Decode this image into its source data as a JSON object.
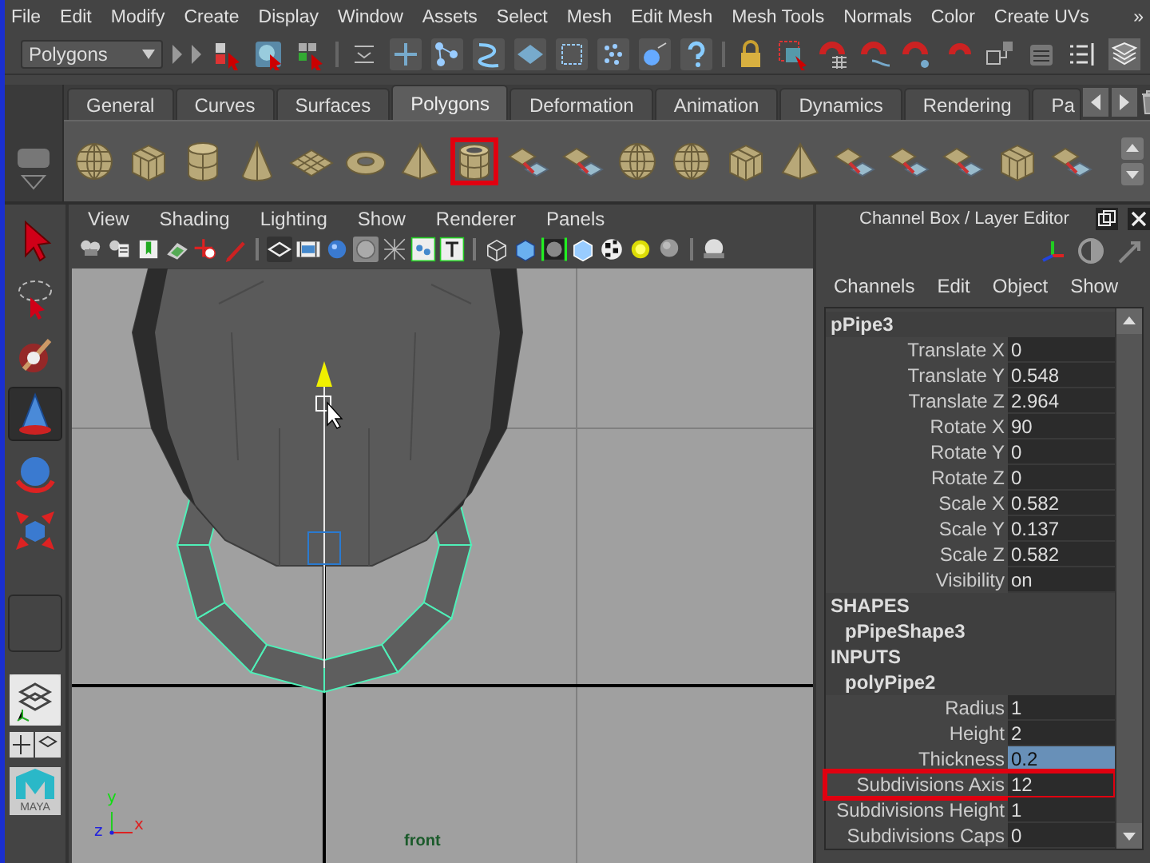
{
  "menu_bar": {
    "items": [
      "File",
      "Edit",
      "Modify",
      "Create",
      "Display",
      "Window",
      "Assets",
      "Select",
      "Mesh",
      "Edit Mesh",
      "Mesh Tools",
      "Normals",
      "Color",
      "Create UVs"
    ],
    "overflow": "»"
  },
  "status_line": {
    "mode_menu": "Polygons"
  },
  "shelf": {
    "tabs": [
      {
        "label": "General",
        "selected": false
      },
      {
        "label": "Curves",
        "selected": false
      },
      {
        "label": "Surfaces",
        "selected": false
      },
      {
        "label": "Polygons",
        "selected": true
      },
      {
        "label": "Deformation",
        "selected": false
      },
      {
        "label": "Animation",
        "selected": false
      },
      {
        "label": "Dynamics",
        "selected": false
      },
      {
        "label": "Rendering",
        "selected": false
      },
      {
        "label": "Pa",
        "selected": false
      }
    ],
    "tools": [
      {
        "kind": "sphere",
        "highlighted": false
      },
      {
        "kind": "cube",
        "highlighted": false
      },
      {
        "kind": "cylinder",
        "highlighted": false
      },
      {
        "kind": "cone",
        "highlighted": false
      },
      {
        "kind": "plane",
        "highlighted": false
      },
      {
        "kind": "torus",
        "highlighted": false
      },
      {
        "kind": "pyramid",
        "highlighted": false
      },
      {
        "kind": "pipe",
        "highlighted": true
      },
      {
        "kind": "mesh-op",
        "highlighted": false
      },
      {
        "kind": "mesh-op",
        "highlighted": false
      },
      {
        "kind": "sphere",
        "highlighted": false
      },
      {
        "kind": "sphere",
        "highlighted": false
      },
      {
        "kind": "cube",
        "highlighted": false
      },
      {
        "kind": "pyramid",
        "highlighted": false
      },
      {
        "kind": "mesh-op",
        "highlighted": false
      },
      {
        "kind": "mesh-op",
        "highlighted": false
      },
      {
        "kind": "mesh-op",
        "highlighted": false
      },
      {
        "kind": "cube",
        "highlighted": false
      },
      {
        "kind": "mesh-op",
        "highlighted": false
      }
    ]
  },
  "toolbox": {
    "logo_text": "MAYA"
  },
  "viewport": {
    "menus": [
      "View",
      "Shading",
      "Lighting",
      "Show",
      "Renderer",
      "Panels"
    ],
    "camera_label": "front",
    "axis_labels": {
      "y": "y",
      "z": "z",
      "x": "x"
    }
  },
  "channel_box": {
    "title": "Channel Box / Layer Editor",
    "menus": [
      "Channels",
      "Edit",
      "Object",
      "Show"
    ],
    "rows": [
      {
        "kind": "object",
        "name": "pPipe3"
      },
      {
        "kind": "attribute",
        "name": "Translate X",
        "value": "0",
        "selected": false,
        "highlighted": false
      },
      {
        "kind": "attribute",
        "name": "Translate Y",
        "value": "0.548",
        "selected": false,
        "highlighted": false
      },
      {
        "kind": "attribute",
        "name": "Translate Z",
        "value": "2.964",
        "selected": false,
        "highlighted": false
      },
      {
        "kind": "attribute",
        "name": "Rotate X",
        "value": "90",
        "selected": false,
        "highlighted": false
      },
      {
        "kind": "attribute",
        "name": "Rotate Y",
        "value": "0",
        "selected": false,
        "highlighted": false
      },
      {
        "kind": "attribute",
        "name": "Rotate Z",
        "value": "0",
        "selected": false,
        "highlighted": false
      },
      {
        "kind": "attribute",
        "name": "Scale X",
        "value": "0.582",
        "selected": false,
        "highlighted": false
      },
      {
        "kind": "attribute",
        "name": "Scale Y",
        "value": "0.137",
        "selected": false,
        "highlighted": false
      },
      {
        "kind": "attribute",
        "name": "Scale Z",
        "value": "0.582",
        "selected": false,
        "highlighted": false
      },
      {
        "kind": "attribute",
        "name": "Visibility",
        "value": "on",
        "selected": false,
        "highlighted": false
      },
      {
        "kind": "section",
        "name": "SHAPES"
      },
      {
        "kind": "node",
        "name": "pPipeShape3"
      },
      {
        "kind": "section",
        "name": "INPUTS"
      },
      {
        "kind": "node",
        "name": "polyPipe2"
      },
      {
        "kind": "attribute",
        "name": "Radius",
        "value": "1",
        "selected": false,
        "highlighted": false
      },
      {
        "kind": "attribute",
        "name": "Height",
        "value": "2",
        "selected": false,
        "highlighted": false
      },
      {
        "kind": "attribute",
        "name": "Thickness",
        "value": "0.2",
        "selected": true,
        "highlighted": false
      },
      {
        "kind": "attribute",
        "name": "Subdivisions Axis",
        "value": "12",
        "selected": false,
        "highlighted": true
      },
      {
        "kind": "attribute",
        "name": "Subdivisions Height",
        "value": "1",
        "selected": false,
        "highlighted": false
      },
      {
        "kind": "attribute",
        "name": "Subdivisions Caps",
        "value": "0",
        "selected": false,
        "highlighted": false
      }
    ]
  }
}
